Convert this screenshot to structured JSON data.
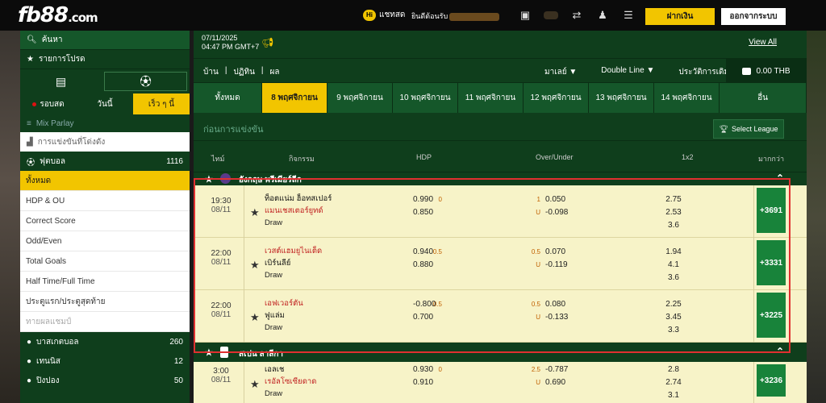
{
  "header": {
    "logo": "fb88",
    "logo_suffix": ".com",
    "chat_badge": "Hi",
    "chat_label": "แชทสด",
    "welcome": "ยินดีต้อนรับ",
    "deposit": "ฝากเงิน",
    "logout": "ออกจากระบบ"
  },
  "sidebar": {
    "search": "ค้นหา",
    "favorites": "รายการโปรด",
    "tabs": [
      "รอบสด",
      "วันนี้",
      "เร็ว ๆ นี้"
    ],
    "mix_parlay": "Mix Parlay",
    "popular": "การแข่งขันที่โด่งดัง",
    "football": {
      "name": "ฟุตบอล",
      "count": "1116"
    },
    "markets": [
      "ทั้งหมด",
      "HDP & OU",
      "Correct Score",
      "Odd/Even",
      "Total Goals",
      "Half Time/Full Time",
      "ประตูแรก/ประตูสุดท้าย",
      "ทายผลแชมป์"
    ],
    "sports": [
      {
        "name": "บาสเกตบอล",
        "count": "260"
      },
      {
        "name": "เทนนิส",
        "count": "12"
      },
      {
        "name": "ปิงปอง",
        "count": "50"
      }
    ]
  },
  "main": {
    "date": "07/11/2025",
    "time": "04:47 PM GMT+7",
    "view_all": "View All",
    "menu_left": [
      "บ้าน",
      "|",
      "ปฏิทิน",
      "|",
      "ผล"
    ],
    "menu_right": [
      "มาเลย์ ▼",
      "Double Line ▼",
      "ประวัติการเดิมพัน"
    ],
    "balance": "0.00 THB",
    "date_tabs": [
      "ทั้งหมด",
      "8 พฤศจิกายน",
      "9 พฤศจิกายน",
      "10 พฤศจิกายน",
      "11 พฤศจิกายน",
      "12 พฤศจิกายน",
      "13 พฤศจิกายน",
      "14 พฤศจิกายน",
      "อื่น"
    ],
    "pre_match": "ก่อนการแข่งขัน",
    "select_league": "Select League",
    "columns": [
      "ไทม์",
      "กิจกรรม",
      "HDP",
      "Over/Under",
      "1x2",
      "มากกว่า"
    ]
  },
  "leagues": [
    {
      "name": "อังกฤษ พรีเมียร์ลีก",
      "matches": [
        {
          "time": "19:30",
          "date": "08/11",
          "home": "ท็อตแน่ม ฮ็อทสเปอร์",
          "away": "แมนเชสเตอร์ยูทด์",
          "draw": "Draw",
          "hdp_h": "0",
          "hdp_odds": [
            "0.990",
            "0.850"
          ],
          "ou_h": [
            "1",
            "U"
          ],
          "ou_odds": [
            "0.050",
            "-0.098"
          ],
          "x12": [
            "2.75",
            "2.53",
            "3.6"
          ],
          "more": "+3691"
        },
        {
          "time": "22:00",
          "date": "08/11",
          "home": "เวสต์แฮมยูไนเต็ด",
          "away": "เบิร์นลีย์",
          "draw": "Draw",
          "hdp_h": "0.5",
          "hdp_odds": [
            "0.940",
            "0.880"
          ],
          "ou_h": [
            "0.5",
            "U"
          ],
          "ou_odds": [
            "0.070",
            "-0.119"
          ],
          "x12": [
            "1.94",
            "4.1",
            "3.6"
          ],
          "more": "+3331"
        },
        {
          "time": "22:00",
          "date": "08/11",
          "home": "เอฟเวอร์ตัน",
          "away": "ฟูแล่ม",
          "draw": "Draw",
          "hdp_h": "0.5",
          "hdp_odds": [
            "-0.800",
            "0.700"
          ],
          "ou_h": [
            "0.5",
            "U"
          ],
          "ou_odds": [
            "0.080",
            "-0.133"
          ],
          "x12": [
            "2.25",
            "3.45",
            "3.3"
          ],
          "more": "+3225"
        }
      ]
    },
    {
      "name": "สเปน ลาลีกา",
      "matches": [
        {
          "time": "3:00",
          "date": "08/11",
          "home": "เอลเช",
          "away": "เรอัลโซเซียดาด",
          "draw": "Draw",
          "hdp_h": "0",
          "hdp_odds": [
            "0.930",
            "0.910"
          ],
          "ou_h": [
            "2.5",
            "U"
          ],
          "ou_odds": [
            "-0.787",
            "0.690"
          ],
          "x12": [
            "2.8",
            "2.74",
            "3.1"
          ],
          "more": "+3236"
        }
      ]
    }
  ]
}
